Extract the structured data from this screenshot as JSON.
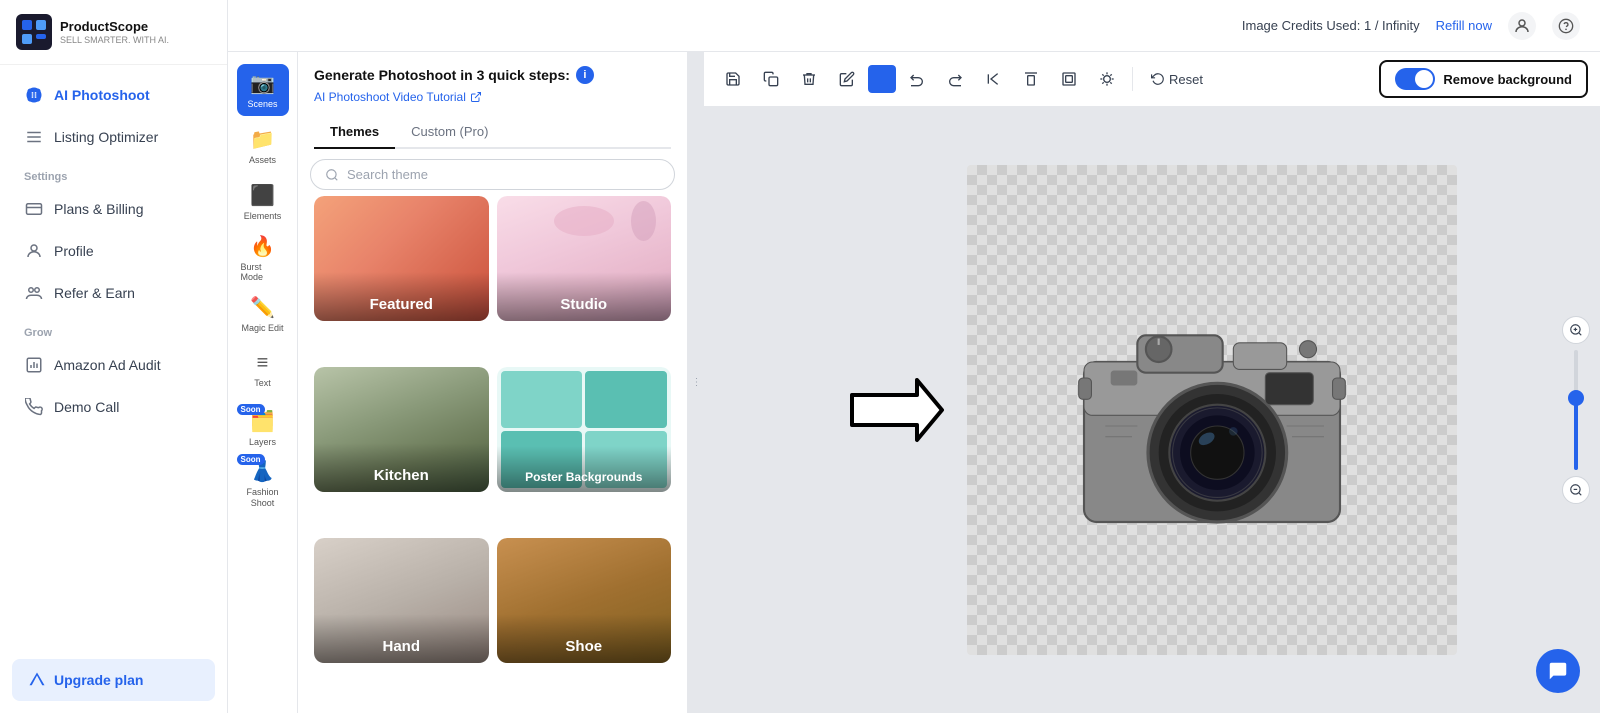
{
  "app": {
    "name": "ProductScope",
    "tagline": "SELL SMARTER. WITH AI."
  },
  "topbar": {
    "credits_label": "Image Credits Used: 1 / Infinity",
    "refill_label": "Refill now"
  },
  "sidebar": {
    "nav_items": [
      {
        "id": "ai-photoshoot",
        "label": "AI Photoshoot",
        "active": true
      },
      {
        "id": "listing-optimizer",
        "label": "Listing Optimizer",
        "active": false
      }
    ],
    "settings_label": "Settings",
    "settings_items": [
      {
        "id": "plans-billing",
        "label": "Plans & Billing"
      },
      {
        "id": "profile",
        "label": "Profile"
      },
      {
        "id": "refer-earn",
        "label": "Refer & Earn"
      }
    ],
    "grow_label": "Grow",
    "grow_items": [
      {
        "id": "amazon-ad-audit",
        "label": "Amazon Ad Audit"
      },
      {
        "id": "demo-call",
        "label": "Demo Call"
      }
    ],
    "upgrade_label": "Upgrade plan"
  },
  "toolbar": {
    "items": [
      {
        "id": "scenes",
        "label": "Scenes",
        "active": true
      },
      {
        "id": "assets",
        "label": "Assets",
        "active": false
      },
      {
        "id": "elements",
        "label": "Elements",
        "active": false
      },
      {
        "id": "burst-mode",
        "label": "Burst Mode",
        "active": false
      },
      {
        "id": "magic-edit",
        "label": "Magic Edit",
        "active": false
      },
      {
        "id": "text",
        "label": "Text",
        "active": false
      },
      {
        "id": "layers",
        "label": "Layers",
        "active": false,
        "soon": true
      },
      {
        "id": "fashion-shoot",
        "label": "Fashion Shoot",
        "active": false,
        "soon": true
      }
    ]
  },
  "themes": {
    "steps_title": "Generate Photoshoot in 3 quick steps:",
    "tutorial_label": "AI Photoshoot Video Tutorial",
    "tabs": [
      {
        "id": "themes",
        "label": "Themes",
        "active": true
      },
      {
        "id": "custom-pro",
        "label": "Custom (Pro)",
        "active": false
      }
    ],
    "search_placeholder": "Search theme",
    "cards": [
      {
        "id": "featured",
        "label": "Featured",
        "class": "theme-featured"
      },
      {
        "id": "studio",
        "label": "Studio",
        "class": "theme-studio"
      },
      {
        "id": "kitchen",
        "label": "Kitchen",
        "class": "theme-kitchen"
      },
      {
        "id": "poster-backgrounds",
        "label": "Poster Backgrounds",
        "class": "theme-poster"
      },
      {
        "id": "hand",
        "label": "Hand",
        "class": "theme-hand"
      },
      {
        "id": "shoe",
        "label": "Shoe",
        "class": "theme-shoe"
      }
    ]
  },
  "canvas": {
    "reset_label": "Reset",
    "remove_bg_label": "Remove background",
    "toggle_on": true
  },
  "chat": {
    "icon": "💬"
  }
}
